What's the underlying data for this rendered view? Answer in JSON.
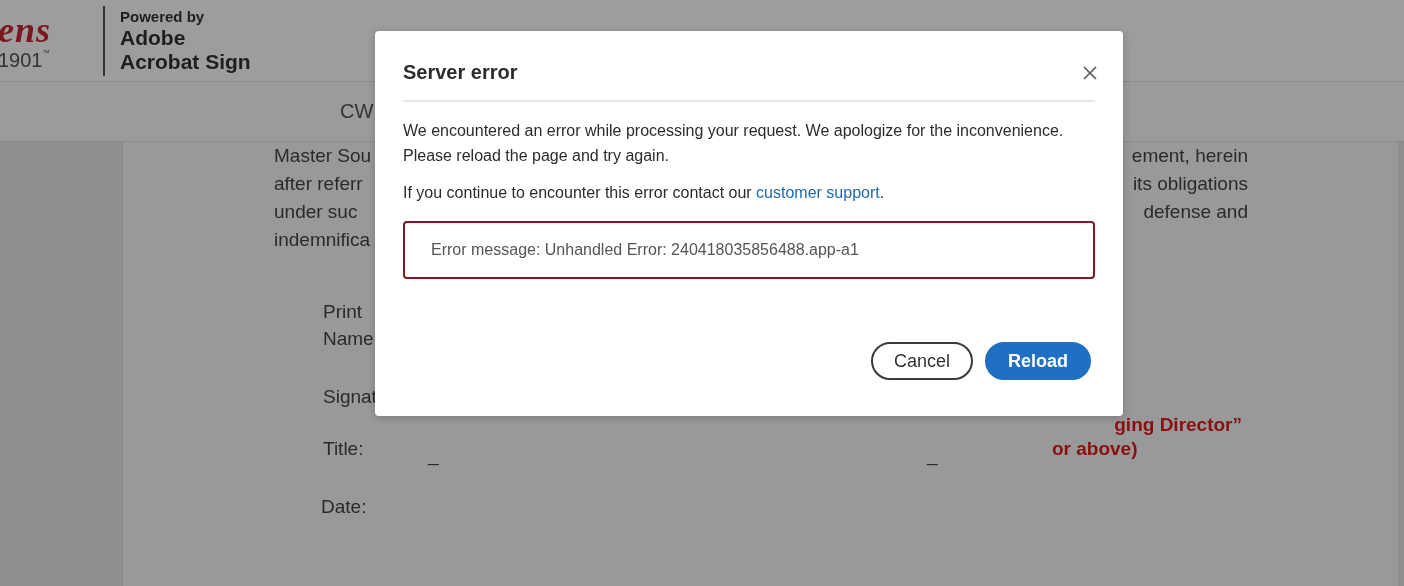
{
  "header": {
    "logo_wordmark": "ens",
    "logo_year": "1901",
    "logo_mark": "™",
    "powered_by": "Powered by",
    "product": [
      "Adobe",
      "Acrobat Sign"
    ]
  },
  "toolbar": {
    "title": "CW"
  },
  "document": {
    "lines": [
      {
        "left": "Master Sou",
        "right": "ement, herein"
      },
      {
        "left": "after referr",
        "right": "its obligations"
      },
      {
        "left": "under suc",
        "right": "defense and"
      },
      {
        "left": "indemnifica"
      }
    ],
    "print_label": [
      "Print",
      "Name"
    ],
    "signature_label": "Signat",
    "note": [
      "ging Director”",
      "or above)"
    ],
    "title_label": "Title:",
    "blanks": [
      "_",
      "_"
    ],
    "date_label": "Date:"
  },
  "dialog": {
    "title": "Server error",
    "paragraphs": [
      "We encountered an error while processing your request. We apologize for the inconvenience. Please reload the page and try again."
    ],
    "support": {
      "prefix": "If you continue to encounter this error contact our ",
      "link": "customer support",
      "suffix": "."
    },
    "error_message": "Error message: Unhandled Error: 240418035856488.app-a1",
    "buttons": [
      {
        "label": "Cancel",
        "kind": "secondary"
      },
      {
        "label": "Reload",
        "kind": "primary"
      }
    ]
  }
}
